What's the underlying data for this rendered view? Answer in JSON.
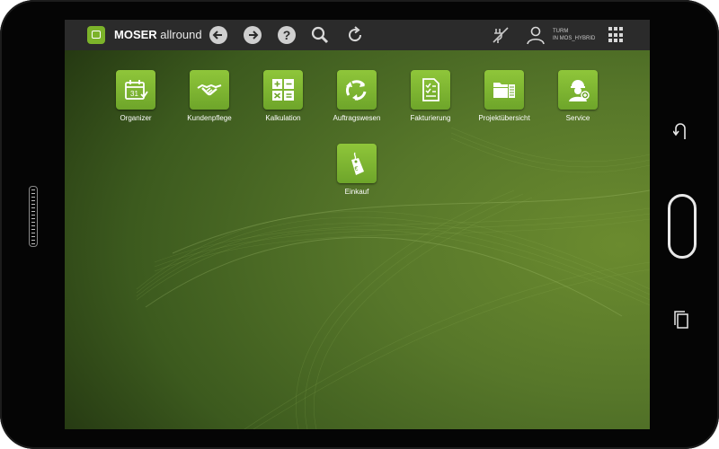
{
  "app": {
    "brand_bold": "MOSER",
    "brand_light": "allround"
  },
  "toolbar": {
    "back_icon": "arrow-left-icon",
    "forward_icon": "arrow-right-icon",
    "help_label": "?",
    "user_line1": "TURM",
    "user_line2": "IN MOS_HYBRID"
  },
  "tiles": [
    {
      "label": "Organizer",
      "icon": "calendar-icon",
      "day": "31"
    },
    {
      "label": "Kundenpflege",
      "icon": "handshake-icon"
    },
    {
      "label": "Kalkulation",
      "icon": "calculator-icon"
    },
    {
      "label": "Auftragswesen",
      "icon": "recycle-icon"
    },
    {
      "label": "Fakturierung",
      "icon": "invoice-icon"
    },
    {
      "label": "Projektübersicht",
      "icon": "folders-icon"
    },
    {
      "label": "Service",
      "icon": "technician-icon"
    },
    {
      "label": "Einkauf",
      "icon": "price-tag-icon"
    }
  ],
  "colors": {
    "accent": "#7cb32a",
    "topbar": "#2b2b2b",
    "tile": "#8fc63a"
  }
}
